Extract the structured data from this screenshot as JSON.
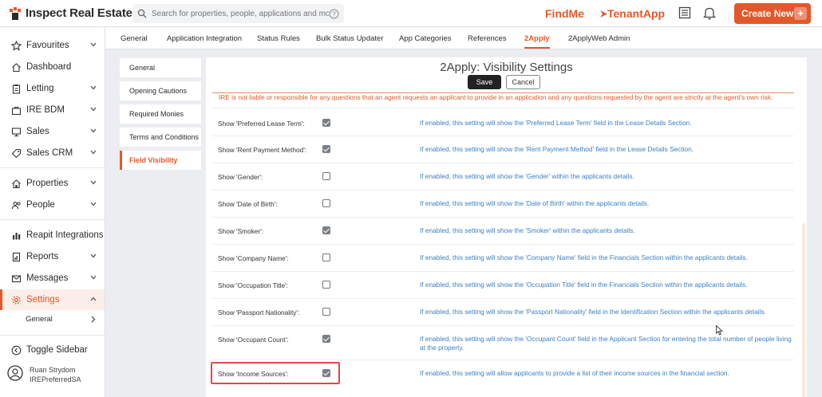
{
  "app": {
    "logo_text": "Inspect Real Estate"
  },
  "search": {
    "placeholder": "Search for properties, people, applications and more!"
  },
  "header": {
    "findme": "FindMe",
    "tenantapp": "TenantApp",
    "create_label": "Create New",
    "create_plus": "+"
  },
  "sidebar": {
    "items": [
      {
        "label": "Favourites",
        "icon": "star-icon",
        "chevron": "down"
      },
      {
        "label": "Dashboard",
        "icon": "home-icon",
        "chevron": ""
      },
      {
        "label": "Letting",
        "icon": "clipboard-icon",
        "chevron": "down"
      },
      {
        "label": "IRE BDM",
        "icon": "briefcase-icon",
        "chevron": "down"
      },
      {
        "label": "Sales",
        "icon": "monitor-icon",
        "chevron": "down"
      },
      {
        "label": "Sales CRM",
        "icon": "tag-icon",
        "chevron": "down"
      },
      {
        "label": "Properties",
        "icon": "house-icon",
        "chevron": "down"
      },
      {
        "label": "People",
        "icon": "people-icon",
        "chevron": "down"
      },
      {
        "label": "Reapit Integrations",
        "icon": "chart-icon",
        "chevron": ""
      },
      {
        "label": "Reports",
        "icon": "report-icon",
        "chevron": "down"
      },
      {
        "label": "Messages",
        "icon": "mail-icon",
        "chevron": "down"
      },
      {
        "label": "Settings",
        "icon": "gear-icon",
        "chevron": "up"
      }
    ],
    "sub_item": "General",
    "toggle_label": "Toggle Sidebar",
    "user": {
      "name": "Ruan Strydom",
      "org": "IREPreferredSA"
    }
  },
  "tabs": [
    "General",
    "Application Integration",
    "Status Rules",
    "Bulk Status Updater",
    "App Categories",
    "References",
    "2Apply",
    "2ApplyWeb Admin"
  ],
  "active_tab": "2Apply",
  "submenu": [
    "General",
    "Opening Cautions",
    "Required Monies",
    "Terms and Conditions",
    "Field Visibility"
  ],
  "active_submenu": "Field Visibility",
  "panel": {
    "title": "2Apply: Visibility Settings",
    "save_label": "Save",
    "cancel_label": "Cancel",
    "disclaimer": "IRE is not liable or responsible for any questions that an agent requests an applicant to provide in an application and any questions requested by the agent are strictly at the agent's own risk."
  },
  "settings": [
    {
      "label": "Show 'Preferred Lease Term':",
      "checked": true,
      "desc": "If enabled, this setting will show the 'Preferred Lease Term' field in the Lease Details Section."
    },
    {
      "label": "Show 'Rent Payment Method':",
      "checked": true,
      "desc": "If enabled, this setting will show the 'Rent Payment Method' field in the Lease Details Section."
    },
    {
      "label": "Show 'Gender':",
      "checked": false,
      "desc": "If enabled, this setting will show the 'Gender' within the applicants details."
    },
    {
      "label": "Show 'Date of Birth':",
      "checked": false,
      "desc": "If enabled, this setting will show the 'Date of Birth' within the applicants details."
    },
    {
      "label": "Show 'Smoker':",
      "checked": true,
      "desc": "If enabled, this setting will show the 'Smoker' within the applicants details."
    },
    {
      "label": "Show 'Company Name':",
      "checked": false,
      "desc": "If enabled, this setting will show the 'Company Name' field in the Financials Section within the applicants details."
    },
    {
      "label": "Show 'Occupation Title':",
      "checked": false,
      "desc": "If enabled, this setting will show the 'Occupation Title' field in the Financials Section within the applicants details."
    },
    {
      "label": "Show 'Passport Nationality':",
      "checked": false,
      "desc": "If enabled, this setting will show the 'Passport Nationality' field in the Identification Section within the applicants details."
    },
    {
      "label": "Show 'Occupant Count':",
      "checked": true,
      "desc": "If enabled, this setting will show the 'Occupant Count' field in the Applicant Section for entering the total number of people living at the property."
    },
    {
      "label": "Show 'Income Sources':",
      "checked": true,
      "desc": "If enabled, this setting will allow applicants to provide a list of their income sources in the financial section."
    }
  ],
  "colors": {
    "accent": "#e2582a",
    "link": "#3b7fc1",
    "highlight": "#e04848"
  }
}
